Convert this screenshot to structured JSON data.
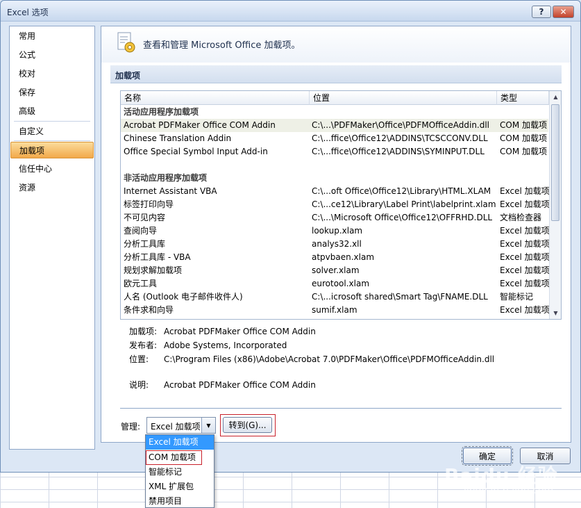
{
  "window": {
    "title": "Excel 选项",
    "help_label": "?",
    "close_label": "✕"
  },
  "nav": {
    "items": [
      {
        "label": "常用"
      },
      {
        "label": "公式"
      },
      {
        "label": "校对"
      },
      {
        "label": "保存"
      },
      {
        "label": "高级"
      },
      {
        "label": "自定义"
      },
      {
        "label": "加载项"
      },
      {
        "label": "信任中心"
      },
      {
        "label": "资源"
      }
    ],
    "active_index": 6
  },
  "header": {
    "text": "查看和管理 Microsoft Office 加载项。",
    "icon": "addin-gear-icon"
  },
  "section": {
    "title": "加载项"
  },
  "table": {
    "columns": [
      "名称",
      "位置",
      "类型"
    ],
    "groups": [
      {
        "title": "活动应用程序加载项",
        "rows": [
          [
            "Acrobat PDFMaker Office COM Addin",
            "C:\\...\\PDFMaker\\Office\\PDFMOfficeAddin.dll",
            "COM 加载项"
          ],
          [
            "Chinese Translation Addin",
            "C:\\...ffice\\Office12\\ADDINS\\TCSCCONV.DLL",
            "COM 加载项"
          ],
          [
            "Office Special Symbol Input Add-in",
            "C:\\...ffice\\Office12\\ADDINS\\SYMINPUT.DLL",
            "COM 加载项"
          ]
        ]
      },
      {
        "title": "非活动应用程序加载项",
        "rows": [
          [
            "Internet Assistant VBA",
            "C:\\...oft Office\\Office12\\Library\\HTML.XLAM",
            "Excel 加载项"
          ],
          [
            "标签打印向导",
            "C:\\...ce12\\Library\\Label Print\\labelprint.xlam",
            "Excel 加载项"
          ],
          [
            "不可见内容",
            "C:\\...\\Microsoft Office\\Office12\\OFFRHD.DLL",
            "文档检查器"
          ],
          [
            "查阅向导",
            "lookup.xlam",
            "Excel 加载项"
          ],
          [
            "分析工具库",
            "analys32.xll",
            "Excel 加载项"
          ],
          [
            "分析工具库 - VBA",
            "atpvbaen.xlam",
            "Excel 加载项"
          ],
          [
            "规划求解加载项",
            "solver.xlam",
            "Excel 加载项"
          ],
          [
            "欧元工具",
            "eurotool.xlam",
            "Excel 加载项"
          ],
          [
            "人名 (Outlook 电子邮件收件人)",
            "C:\\...icrosoft shared\\Smart Tag\\FNAME.DLL",
            "智能标记"
          ],
          [
            "条件求和向导",
            "sumif.xlam",
            "Excel 加载项"
          ]
        ]
      }
    ]
  },
  "details": {
    "addin_label": "加载项:",
    "addin_value": "Acrobat PDFMaker Office COM Addin",
    "publisher_label": "发布者:",
    "publisher_value": "Adobe Systems, Incorporated",
    "location_label": "位置:",
    "location_value": "C:\\Program Files (x86)\\Adobe\\Acrobat 7.0\\PDFMaker\\Office\\PDFMOfficeAddin.dll",
    "desc_label": "说明:",
    "desc_value": "Acrobat PDFMaker Office COM Addin"
  },
  "manage": {
    "label": "管理:",
    "selected": "Excel 加载项",
    "go_label": "转到(G)...",
    "options": [
      "Excel 加载项",
      "COM 加载项",
      "智能标记",
      "XML 扩展包",
      "禁用项目"
    ],
    "highlighted_index": 0
  },
  "buttons": {
    "ok": "确定",
    "cancel": "取消"
  },
  "watermark": {
    "main": "Baidu 经验",
    "sub": "jingyan.baidu.com"
  },
  "colors": {
    "selection": "#3399ff",
    "highlight_outline": "#c8202a",
    "active_nav": "#f2a94a"
  }
}
